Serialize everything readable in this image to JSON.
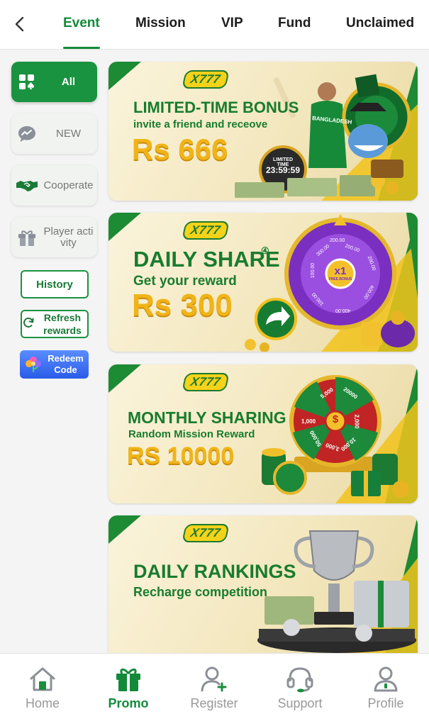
{
  "tabs": [
    {
      "label": "Event",
      "active": true
    },
    {
      "label": "Mission",
      "active": false
    },
    {
      "label": "VIP",
      "active": false
    },
    {
      "label": "Fund",
      "active": false
    },
    {
      "label": "Unclaimed",
      "active": false
    }
  ],
  "sidebar": {
    "categories": [
      {
        "label": "All",
        "icon": "grid-spade-icon",
        "active": true
      },
      {
        "label": "NEW",
        "icon": "chat-trend-icon",
        "active": false
      },
      {
        "label": "Cooperate",
        "icon": "handshake-icon",
        "active": false
      },
      {
        "label": "Player activity",
        "icon": "gift-box-icon",
        "active": false
      }
    ],
    "history_label": "History",
    "refresh_label": "Refresh rewards",
    "redeem_label": "Redeem Code"
  },
  "banners": [
    {
      "logo": "X777",
      "title": "LIMITED-TIME BONUS",
      "subtitle": "invite a friend and receove",
      "amount": "Rs 666",
      "timer_label": "LIMITED TIME",
      "timer_value": "23:59:59",
      "player_jersey": "BANGLADESH"
    },
    {
      "logo": "X777",
      "title": "DAILY SHARE",
      "title_mark": "④",
      "subtitle": "Get your reward",
      "amount": "Rs 300",
      "wheel_center": "x1",
      "wheel_center_sub": "FREE BONUS",
      "wheel_values": [
        "200.00",
        "200.00",
        "400.00",
        "400.00",
        "100.00",
        "100.00",
        "300.00",
        "200.00"
      ]
    },
    {
      "logo": "X777",
      "title": "MONTHLY SHARING",
      "subtitle": "Random Mission Reward",
      "amount": "RS 10000",
      "wheel_center": "$",
      "wheel_values": [
        "5,000",
        "20000",
        "2,000",
        "10,000",
        "3,000",
        "50,000",
        "1,000"
      ]
    },
    {
      "logo": "X777",
      "title": "DAILY RANKINGS",
      "subtitle": "Recharge competition"
    }
  ],
  "bottom_nav": [
    {
      "label": "Home",
      "icon": "home-icon",
      "active": false
    },
    {
      "label": "Promo",
      "icon": "gift-icon",
      "active": true
    },
    {
      "label": "Register",
      "icon": "user-add-icon",
      "active": false
    },
    {
      "label": "Support",
      "icon": "headset-icon",
      "active": false
    },
    {
      "label": "Profile",
      "icon": "profile-icon",
      "active": false
    }
  ],
  "colors": {
    "accent": "#138a3a",
    "gold": "#f0b418",
    "banner_green": "#1d7a2e"
  }
}
